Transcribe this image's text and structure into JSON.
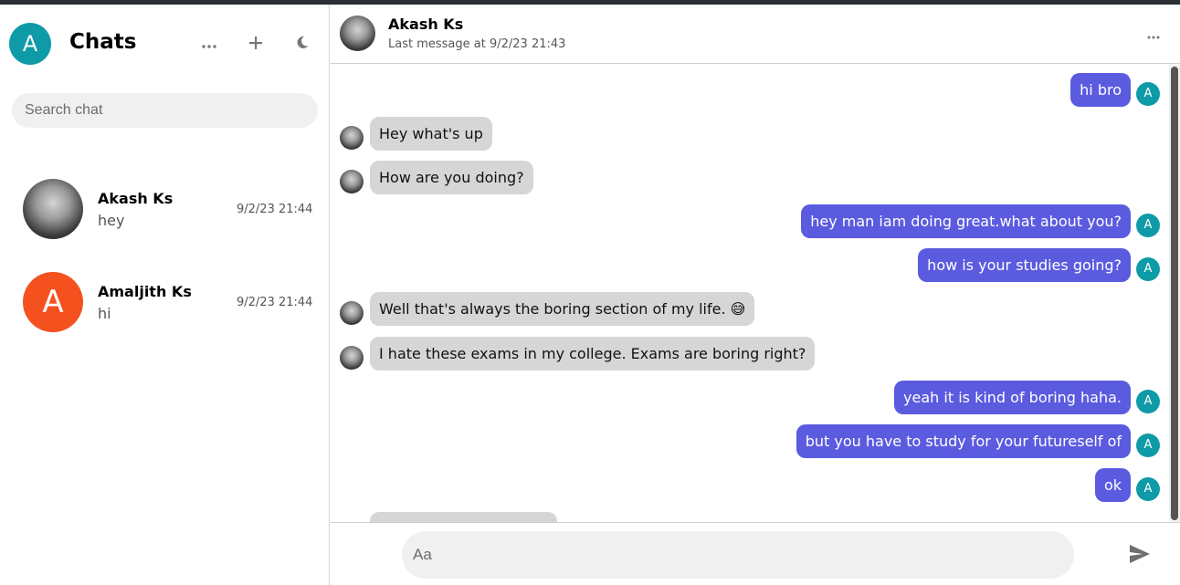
{
  "sidebar": {
    "avatar_letter": "A",
    "title": "Chats",
    "more_icon": "more-horizontal-icon",
    "add_icon": "plus-icon",
    "theme_icon": "moon-icon",
    "search_placeholder": "Search chat",
    "chats": [
      {
        "name": "Akash Ks",
        "last_message": "hey",
        "time": "9/2/23 21:44",
        "avatar": "photo"
      },
      {
        "name": "Amaljith Ks",
        "last_message": "hi",
        "time": "9/2/23 21:44",
        "avatar_letter": "A",
        "avatar_color": "#f4511e"
      }
    ]
  },
  "header": {
    "name": "Akash Ks",
    "subtitle": "Last message at 9/2/23 21:43"
  },
  "messages": [
    {
      "dir": "out",
      "text": "hi bro",
      "avatar": "A"
    },
    {
      "dir": "in",
      "text": "Hey what's up"
    },
    {
      "dir": "in",
      "text": "How are you doing?"
    },
    {
      "dir": "out",
      "text": "hey man iam doing great.what about you?",
      "avatar": "A"
    },
    {
      "dir": "out",
      "text": "how is your studies going?",
      "avatar": "A"
    },
    {
      "dir": "in",
      "text": "Well that's always the boring section of my life. 😅"
    },
    {
      "dir": "in",
      "text": "I hate these exams in my college. Exams are boring right?"
    },
    {
      "dir": "out",
      "text": "yeah it is kind of boring haha.",
      "avatar": "A"
    },
    {
      "dir": "out",
      "text": "but you have to study for your futureself of",
      "avatar": "A"
    },
    {
      "dir": "out",
      "text": "ok",
      "avatar": "A"
    }
  ],
  "composer": {
    "placeholder": "Aa",
    "send_icon": "send-icon"
  },
  "colors": {
    "accent": "#5b5be0",
    "me_avatar": "#0e9aa7",
    "incoming_bubble": "#d6d6d6"
  }
}
